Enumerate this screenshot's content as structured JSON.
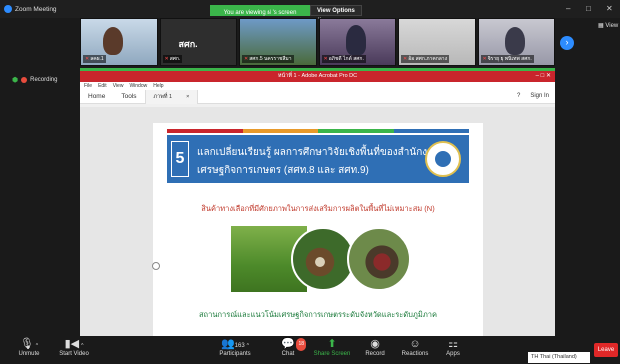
{
  "window": {
    "app_title": "Zoom Meeting",
    "share_notice": "You are viewing ผ่ 's screen",
    "view_options_label": "View Options",
    "controls": [
      "–",
      "□",
      "✕"
    ]
  },
  "participants_strip": {
    "tiles": [
      {
        "name": "ลคผ.1",
        "muted": true
      },
      {
        "name": "สศก.",
        "muted": true
      },
      {
        "name": "สศก.5 นครราชสีมา",
        "muted": true
      },
      {
        "name": "อภิชดี ไกด์ สศก.",
        "muted": true
      },
      {
        "name": "อ้อ สศก.ภาคกลาง",
        "muted": true
      },
      {
        "name": "จิรายุ ยุ พนิเทพ สศก.",
        "muted": true
      }
    ],
    "big_label": "สศก.",
    "next_icon": "chevron-right-icon",
    "view_label": "View"
  },
  "recording": {
    "label": "Recording"
  },
  "acrobat": {
    "title": "หน้าที่ 1 - Adobe Acrobat Pro DC",
    "menu": [
      "File",
      "Edit",
      "View",
      "Window",
      "Help"
    ],
    "tabs": {
      "home": "Home",
      "tools": "Tools",
      "doc": "ภาพที่ 1",
      "close": "×"
    },
    "right": {
      "help": "?",
      "sign_in": "Sign In"
    }
  },
  "slide": {
    "number": "5",
    "heading_line1": "แลกเปลี่ยนเรียนรู้ ผลการศึกษาวิจัยเชิงพื้นที่ของสำนักงาน",
    "heading_line2": "เศรษฐกิจการเกษตร (สศท.8 และ สศท.9)",
    "subtitle": "สินค้าทางเลือกที่มีศักยภาพในการส่งเสริมการผลิตในพื้นที่ไม่เหมาะสม (N)",
    "footer": "สถานการณ์และแนวโน้มเศรษฐกิจการเกษตรระดับจังหวัดและระดับภูมิภาค",
    "stripe_colors": [
      "#c9252c",
      "#e89a2b",
      "#3bb54a",
      "#2f6fb5"
    ]
  },
  "toolbar": {
    "unmute": "Unmute",
    "start_video": "Start Video",
    "participants": "Participants",
    "participants_count": "163",
    "chat": "Chat",
    "chat_badge": "18",
    "share_screen": "Share Screen",
    "record": "Record",
    "reactions": "Reactions",
    "apps": "Apps",
    "leave": "Leave",
    "language": "TH Thai (Thailand)"
  }
}
